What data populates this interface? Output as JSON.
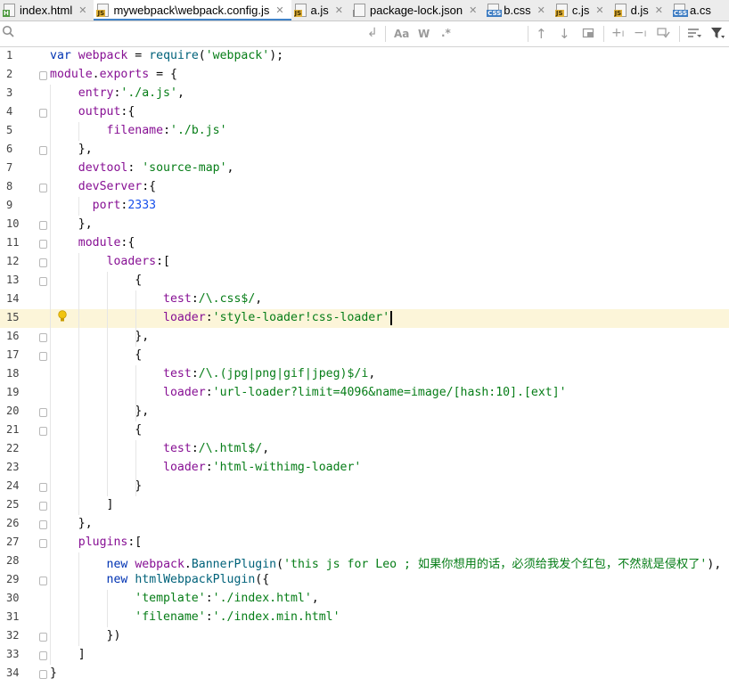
{
  "tabs": [
    {
      "label": "index.html",
      "icon": "html-file-icon",
      "badge": "H",
      "type": "h",
      "active": false
    },
    {
      "label": "mywebpack\\webpack.config.js",
      "icon": "js-file-icon",
      "badge": "JS",
      "type": "js",
      "active": true
    },
    {
      "label": "a.js",
      "icon": "js-file-icon",
      "badge": "JS",
      "type": "js",
      "active": false
    },
    {
      "label": "package-lock.json",
      "icon": "json-file-icon",
      "badge": "",
      "type": "json",
      "active": false
    },
    {
      "label": "b.css",
      "icon": "css-file-icon",
      "badge": "CSS",
      "type": "css",
      "active": false
    },
    {
      "label": "c.js",
      "icon": "js-file-icon",
      "badge": "JS",
      "type": "js",
      "active": false
    },
    {
      "label": "d.js",
      "icon": "js-file-icon",
      "badge": "JS",
      "type": "js",
      "active": false
    },
    {
      "label": "a.cs",
      "icon": "css-file-icon",
      "badge": "CSS",
      "type": "css",
      "active": false
    }
  ],
  "search_toolbar": {
    "search_icon": "search-icon",
    "match_case_label": "Aa",
    "whole_words_label": "W",
    "regex_label": ".*"
  },
  "current_line": 15,
  "lines": [
    {
      "n": "1",
      "t": [
        [
          "kw",
          "var"
        ],
        [
          "def",
          " "
        ],
        [
          "id",
          "webpack"
        ],
        [
          "def",
          " = "
        ],
        [
          "fn",
          "require"
        ],
        [
          "def",
          "("
        ],
        [
          "str",
          "'webpack'"
        ],
        [
          "def",
          ");"
        ]
      ]
    },
    {
      "n": "2",
      "t": [
        [
          "id",
          "module"
        ],
        [
          "def",
          "."
        ],
        [
          "id",
          "exports"
        ],
        [
          "def",
          " = {"
        ]
      ]
    },
    {
      "n": "3",
      "t": [
        [
          "def",
          "    "
        ],
        [
          "id",
          "entry"
        ],
        [
          "def",
          ":"
        ],
        [
          "str",
          "'./a.js'"
        ],
        [
          "def",
          ","
        ]
      ]
    },
    {
      "n": "4",
      "t": [
        [
          "def",
          "    "
        ],
        [
          "id",
          "output"
        ],
        [
          "def",
          ":{"
        ]
      ]
    },
    {
      "n": "5",
      "t": [
        [
          "def",
          "        "
        ],
        [
          "id",
          "filename"
        ],
        [
          "def",
          ":"
        ],
        [
          "str",
          "'./b.js'"
        ]
      ]
    },
    {
      "n": "6",
      "t": [
        [
          "def",
          "    },"
        ]
      ]
    },
    {
      "n": "7",
      "t": [
        [
          "def",
          "    "
        ],
        [
          "id",
          "devtool"
        ],
        [
          "def",
          ": "
        ],
        [
          "str",
          "'source-map'"
        ],
        [
          "def",
          ","
        ]
      ]
    },
    {
      "n": "8",
      "t": [
        [
          "def",
          "    "
        ],
        [
          "id",
          "devServer"
        ],
        [
          "def",
          ":{"
        ]
      ]
    },
    {
      "n": "9",
      "t": [
        [
          "def",
          "      "
        ],
        [
          "id",
          "port"
        ],
        [
          "def",
          ":"
        ],
        [
          "num",
          "2333"
        ]
      ]
    },
    {
      "n": "10",
      "t": [
        [
          "def",
          "    },"
        ]
      ]
    },
    {
      "n": "11",
      "t": [
        [
          "def",
          "    "
        ],
        [
          "id",
          "module"
        ],
        [
          "def",
          ":{"
        ]
      ]
    },
    {
      "n": "12",
      "t": [
        [
          "def",
          "        "
        ],
        [
          "id",
          "loaders"
        ],
        [
          "def",
          ":["
        ]
      ]
    },
    {
      "n": "13",
      "t": [
        [
          "def",
          "            {"
        ]
      ]
    },
    {
      "n": "14",
      "t": [
        [
          "def",
          "                "
        ],
        [
          "id",
          "test"
        ],
        [
          "def",
          ":"
        ],
        [
          "rx",
          "/\\.css$/"
        ],
        [
          "def",
          ","
        ]
      ]
    },
    {
      "n": "15",
      "t": [
        [
          "def",
          "                "
        ],
        [
          "id",
          "loader"
        ],
        [
          "def",
          ":"
        ],
        [
          "str",
          "'style-loader!css-loader'"
        ]
      ]
    },
    {
      "n": "16",
      "t": [
        [
          "def",
          "            },"
        ]
      ]
    },
    {
      "n": "17",
      "t": [
        [
          "def",
          "            {"
        ]
      ]
    },
    {
      "n": "18",
      "t": [
        [
          "def",
          "                "
        ],
        [
          "id",
          "test"
        ],
        [
          "def",
          ":"
        ],
        [
          "rx",
          "/\\.(jpg|png|gif|jpeg)$/i"
        ],
        [
          "def",
          ","
        ]
      ]
    },
    {
      "n": "19",
      "t": [
        [
          "def",
          "                "
        ],
        [
          "id",
          "loader"
        ],
        [
          "def",
          ":"
        ],
        [
          "str",
          "'url-loader?limit=4096&name=image/[hash:10].[ext]'"
        ]
      ]
    },
    {
      "n": "20",
      "t": [
        [
          "def",
          "            },"
        ]
      ]
    },
    {
      "n": "21",
      "t": [
        [
          "def",
          "            {"
        ]
      ]
    },
    {
      "n": "22",
      "t": [
        [
          "def",
          "                "
        ],
        [
          "id",
          "test"
        ],
        [
          "def",
          ":"
        ],
        [
          "rx",
          "/\\.html$/"
        ],
        [
          "def",
          ","
        ]
      ]
    },
    {
      "n": "23",
      "t": [
        [
          "def",
          "                "
        ],
        [
          "id",
          "loader"
        ],
        [
          "def",
          ":"
        ],
        [
          "str",
          "'html-withimg-loader'"
        ]
      ]
    },
    {
      "n": "24",
      "t": [
        [
          "def",
          "            }"
        ]
      ]
    },
    {
      "n": "25",
      "t": [
        [
          "def",
          "        ]"
        ]
      ]
    },
    {
      "n": "26",
      "t": [
        [
          "def",
          "    },"
        ]
      ]
    },
    {
      "n": "27",
      "t": [
        [
          "def",
          "    "
        ],
        [
          "id",
          "plugins"
        ],
        [
          "def",
          ":["
        ]
      ]
    },
    {
      "n": "28",
      "t": [
        [
          "def",
          "        "
        ],
        [
          "kw",
          "new"
        ],
        [
          "def",
          " "
        ],
        [
          "id",
          "webpack"
        ],
        [
          "def",
          "."
        ],
        [
          "cls",
          "BannerPlugin"
        ],
        [
          "def",
          "("
        ],
        [
          "str",
          "'this js for Leo ; 如果你想用的话，必须给我发个红包，不然就是侵权了'"
        ],
        [
          "def",
          "),"
        ]
      ]
    },
    {
      "n": "29",
      "t": [
        [
          "def",
          "        "
        ],
        [
          "kw",
          "new"
        ],
        [
          "def",
          " "
        ],
        [
          "cls",
          "htmlWebpackPlugin"
        ],
        [
          "def",
          "({"
        ]
      ]
    },
    {
      "n": "30",
      "t": [
        [
          "def",
          "            "
        ],
        [
          "str",
          "'template'"
        ],
        [
          "def",
          ":"
        ],
        [
          "str",
          "'./index.html'"
        ],
        [
          "def",
          ","
        ]
      ]
    },
    {
      "n": "31",
      "t": [
        [
          "def",
          "            "
        ],
        [
          "str",
          "'filename'"
        ],
        [
          "def",
          ":"
        ],
        [
          "str",
          "'./index.min.html'"
        ]
      ]
    },
    {
      "n": "32",
      "t": [
        [
          "def",
          "        })"
        ]
      ]
    },
    {
      "n": "33",
      "t": [
        [
          "def",
          "    ]"
        ]
      ]
    },
    {
      "n": "34",
      "t": [
        [
          "def",
          "}"
        ]
      ]
    }
  ]
}
